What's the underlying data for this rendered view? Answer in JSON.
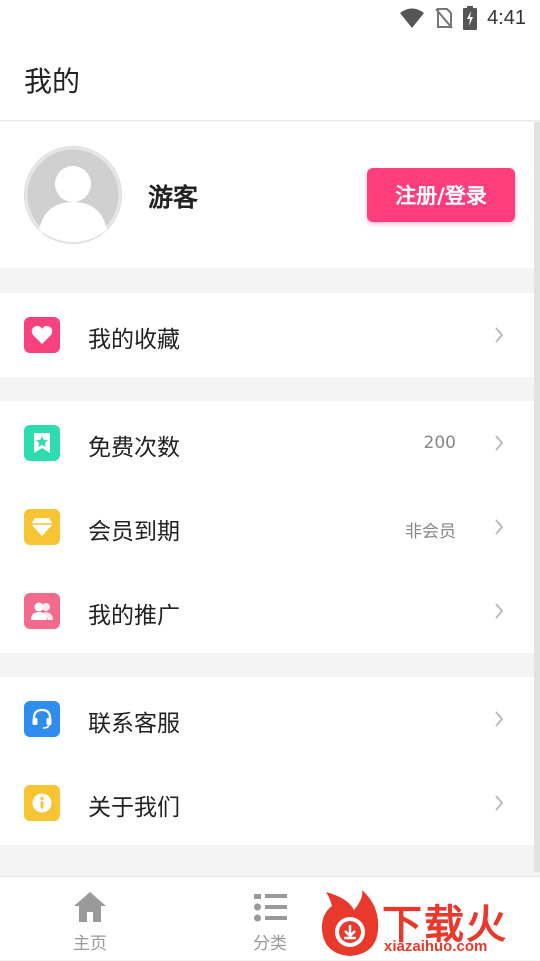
{
  "status_bar": {
    "time": "4:41",
    "icons": [
      "wifi-icon",
      "no-sim-icon",
      "battery-charging-icon"
    ]
  },
  "header": {
    "title": "我的"
  },
  "profile": {
    "avatar_icon": "user-avatar-icon",
    "username": "游客",
    "login_button": "注册/登录",
    "login_button_color": "#fe3d7d"
  },
  "menu": {
    "favorites": {
      "label": "我的收藏",
      "icon": "heart-icon",
      "color": "#f7427d"
    },
    "free_times": {
      "label": "免费次数",
      "value": "200",
      "icon": "ticket-star-icon",
      "color": "#2fdcb0"
    },
    "vip_expire": {
      "label": "会员到期",
      "value": "非会员",
      "icon": "diamond-icon",
      "color": "#f7c434"
    },
    "promotion": {
      "label": "我的推广",
      "icon": "users-icon",
      "color": "#f36a8f"
    },
    "contact": {
      "label": "联系客服",
      "icon": "headset-icon",
      "color": "#2f8df0"
    },
    "about": {
      "label": "关于我们",
      "icon": "info-icon",
      "color": "#f7c434"
    }
  },
  "tabbar": {
    "tabs": [
      {
        "label": "主页",
        "icon": "home-icon"
      },
      {
        "label": "分类",
        "icon": "list-icon"
      }
    ]
  },
  "watermark": {
    "text": "下载火",
    "url": "xiazaihuo.com",
    "color": "#e8392c"
  }
}
